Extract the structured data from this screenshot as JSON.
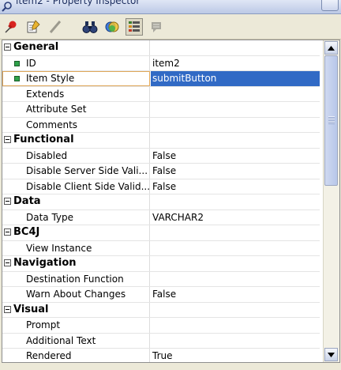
{
  "window": {
    "title": "item2 - Property Inspector"
  },
  "toolbar": {
    "buttons": [
      {
        "icon": "pin-icon"
      },
      {
        "icon": "edit-icon"
      },
      {
        "icon": "pencil-icon"
      },
      {
        "icon": "binoculars-icon"
      },
      {
        "icon": "color-circles-icon"
      },
      {
        "icon": "categorize-icon",
        "active": true
      },
      {
        "icon": "notes-icon"
      }
    ]
  },
  "groups": [
    {
      "label": "General",
      "props": [
        {
          "name": "ID",
          "value": "item2",
          "required": true
        },
        {
          "name": "Item Style",
          "value": "submitButton",
          "required": true,
          "selected": true
        },
        {
          "name": "Extends",
          "value": ""
        },
        {
          "name": "Attribute Set",
          "value": ""
        },
        {
          "name": "Comments",
          "value": ""
        }
      ]
    },
    {
      "label": "Functional",
      "props": [
        {
          "name": "Disabled",
          "value": "False"
        },
        {
          "name": "Disable Server Side Vali...",
          "value": "False"
        },
        {
          "name": "Disable Client Side Valid...",
          "value": "False"
        }
      ]
    },
    {
      "label": "Data",
      "props": [
        {
          "name": "Data Type",
          "value": "VARCHAR2"
        }
      ]
    },
    {
      "label": "BC4J",
      "props": [
        {
          "name": "View Instance",
          "value": ""
        }
      ]
    },
    {
      "label": "Navigation",
      "props": [
        {
          "name": "Destination Function",
          "value": ""
        },
        {
          "name": "Warn About Changes",
          "value": "False"
        }
      ]
    },
    {
      "label": "Visual",
      "props": [
        {
          "name": "Prompt",
          "value": ""
        },
        {
          "name": "Additional Text",
          "value": ""
        },
        {
          "name": "Rendered",
          "value": "True"
        }
      ]
    }
  ]
}
